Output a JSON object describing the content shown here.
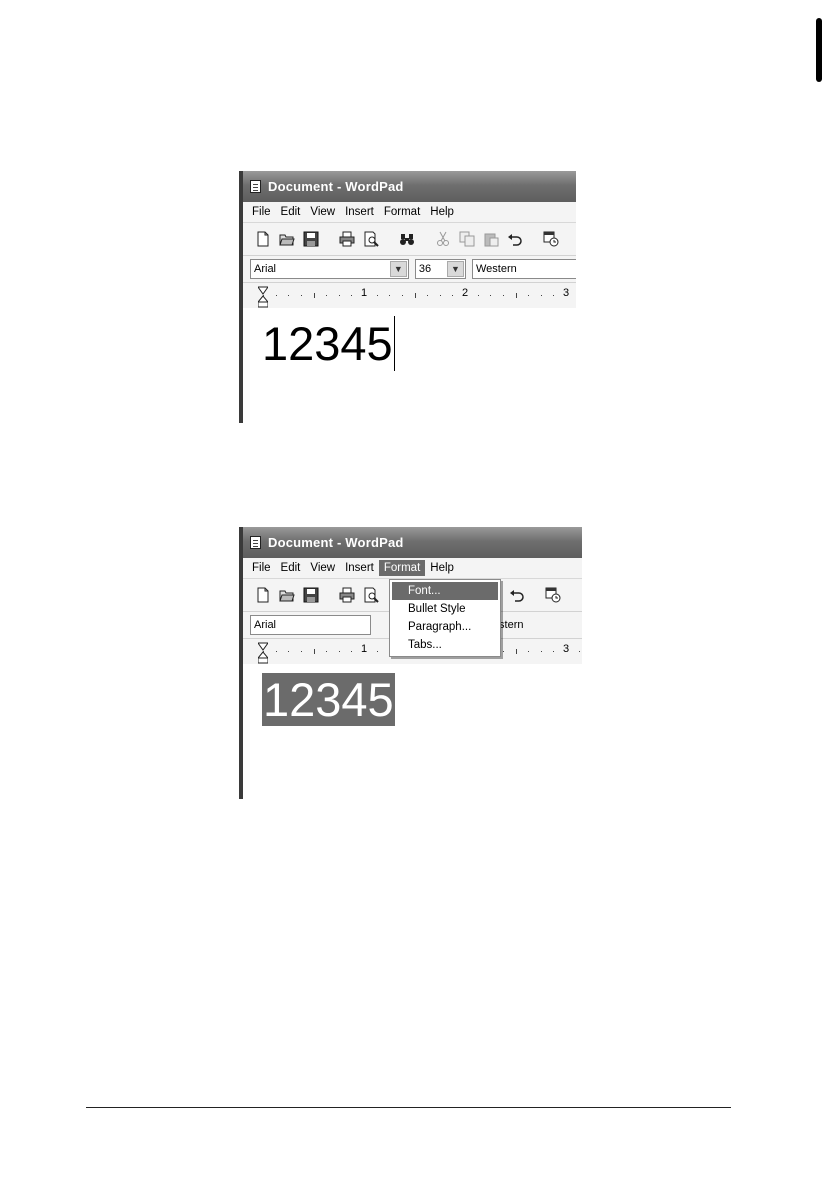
{
  "window": {
    "title": "Document - WordPad"
  },
  "menu": {
    "file": "File",
    "edit": "Edit",
    "view": "View",
    "insert": "Insert",
    "format": "Format",
    "help": "Help"
  },
  "toolbar": {
    "icons": [
      "new-document-icon",
      "open-folder-icon",
      "save-disk-icon",
      "print-icon",
      "print-preview-icon",
      "find-binoculars-icon",
      "cut-scissors-icon",
      "copy-icon",
      "paste-icon",
      "undo-icon",
      "date-time-icon"
    ]
  },
  "formatbar": {
    "font": "Arial",
    "size": "36",
    "script": "Western"
  },
  "ruler": {
    "numbers": [
      "1",
      "2",
      "3"
    ]
  },
  "document": {
    "text": "12345"
  },
  "format_menu": {
    "items": [
      "Font...",
      "Bullet Style",
      "Paragraph...",
      "Tabs..."
    ],
    "highlighted": "Font..."
  },
  "colors": {
    "titlebar": "#6f6f6f",
    "selection": "#6b6b6b"
  }
}
